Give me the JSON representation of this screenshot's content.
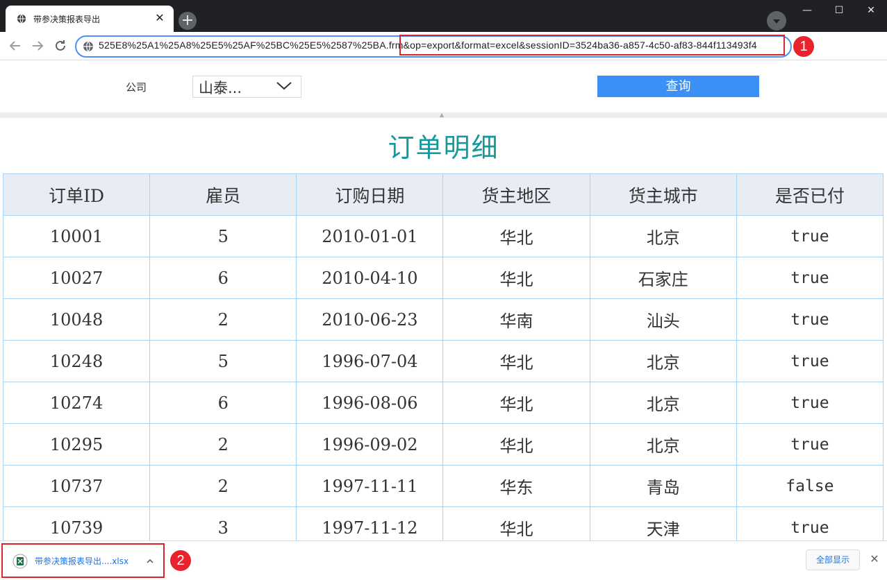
{
  "browser": {
    "tab_title": "带参决策报表导出",
    "tab_close": "✕",
    "new_tab": "+",
    "window_controls": [
      "—",
      "☐",
      "✕"
    ],
    "url": "525E8%25A1%25A8%25E5%25AF%25BC%25E5%2587%25BA.frm&op=export&format=excel&sessionID=3524ba36-a857-4c50-af83-844f113493f4",
    "icons": [
      "back-arrow-icon",
      "forward-arrow-icon",
      "reload-icon",
      "site-info-icon",
      "extensions-icon",
      "profile-icon",
      "menu-icon",
      "tab-search-icon"
    ]
  },
  "annotations": {
    "badge1": "1",
    "badge2": "2",
    "highlight_color": "#d9242e"
  },
  "query": {
    "company_label": "公司",
    "company_value": "山泰...",
    "query_button": "查询"
  },
  "report": {
    "title": "订单明细",
    "title_color": "#15999a",
    "columns": [
      "订单ID",
      "雇员",
      "订购日期",
      "货主地区",
      "货主城市",
      "是否已付"
    ],
    "rows": [
      [
        "10001",
        "5",
        "2010-01-01",
        "华北",
        "北京",
        "true"
      ],
      [
        "10027",
        "6",
        "2010-04-10",
        "华北",
        "石家庄",
        "true"
      ],
      [
        "10048",
        "2",
        "2010-06-23",
        "华南",
        "汕头",
        "true"
      ],
      [
        "10248",
        "5",
        "1996-07-04",
        "华北",
        "北京",
        "true"
      ],
      [
        "10274",
        "6",
        "1996-08-06",
        "华北",
        "北京",
        "true"
      ],
      [
        "10295",
        "2",
        "1996-09-02",
        "华北",
        "北京",
        "true"
      ],
      [
        "10737",
        "2",
        "1997-11-11",
        "华东",
        "青岛",
        "false"
      ],
      [
        "10739",
        "3",
        "1997-11-12",
        "华北",
        "天津",
        "true"
      ]
    ]
  },
  "download": {
    "file_name": "带参决策报表导出....xlsx",
    "show_all": "全部显示",
    "close": "✕"
  }
}
